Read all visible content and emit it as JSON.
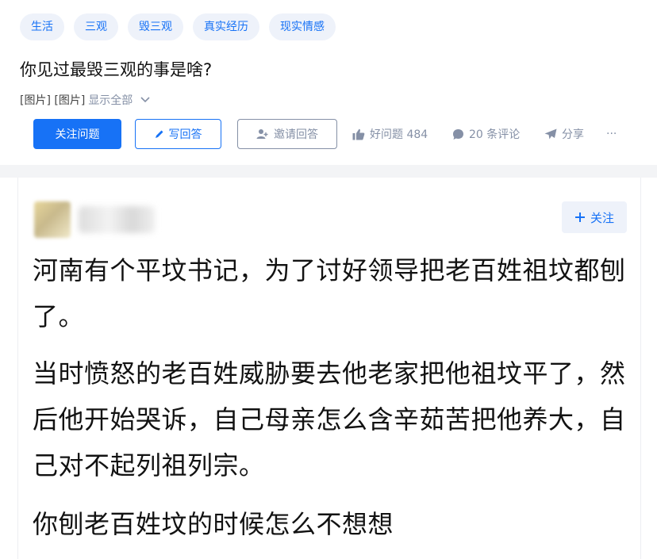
{
  "question": {
    "tags": [
      "生活",
      "三观",
      "毁三观",
      "真实经历",
      "现实情感"
    ],
    "title": "你见过最毁三观的事是啥?",
    "excerpt": {
      "images": "[图片] [图片]",
      "show_all": "显示全部"
    },
    "actions": {
      "follow_label": "关注问题",
      "write_label": "写回答",
      "invite_label": "邀请回答",
      "good_question": "好问题 484",
      "comments": "20 条评论",
      "share": "分享",
      "more": "···"
    }
  },
  "answer": {
    "follow_label": "关注",
    "paragraphs": [
      "河南有个平坟书记，为了讨好领导把老百姓祖坟都刨了。",
      "当时愤怒的老百姓威胁要去他老家把他祖坟平了，然后他开始哭诉，自己母亲怎么含辛茹苦把他养大，自己对不起列祖列宗。",
      "你刨老百姓坟的时候怎么不想想"
    ]
  },
  "colors": {
    "accent": "#1772f6",
    "tag_bg": "#eef2fa",
    "muted": "#8590a6",
    "divider": "#f3f4f6"
  }
}
